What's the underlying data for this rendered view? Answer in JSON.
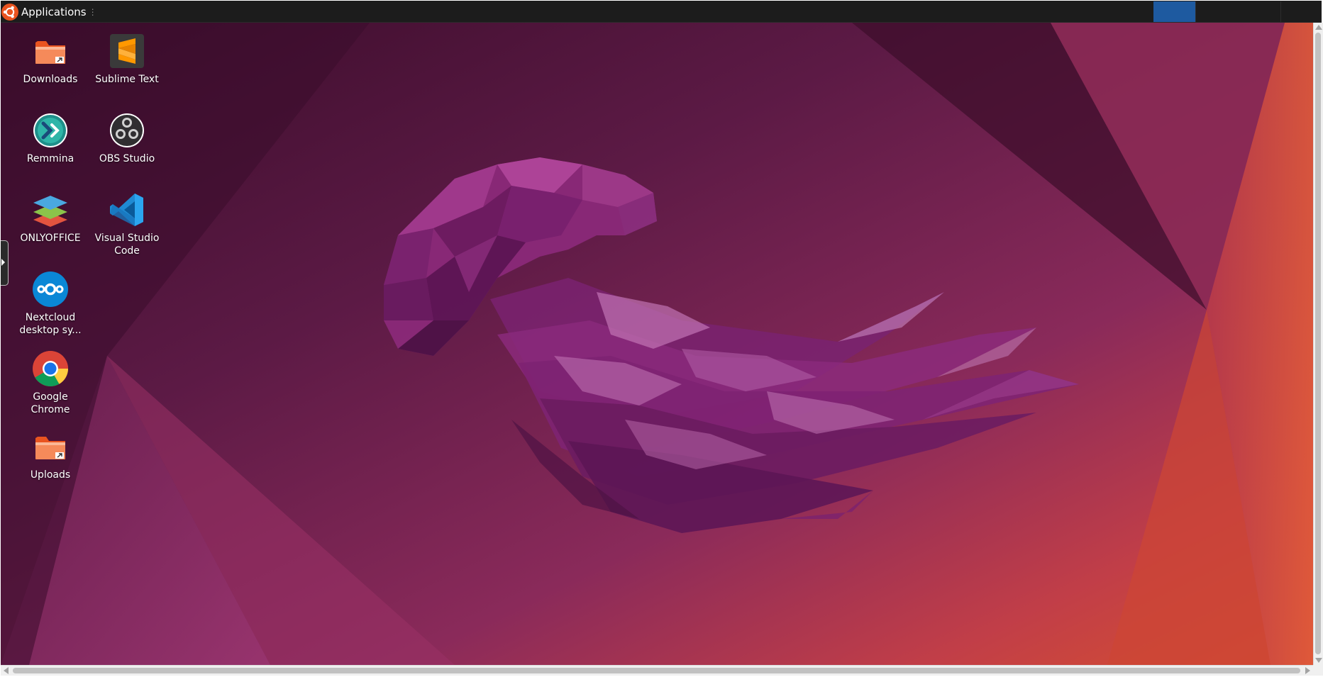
{
  "top_panel": {
    "apps_menu_label": "Applications",
    "apps_menu_icon": "ubuntu-logo-icon",
    "handle_glyph": "⋮"
  },
  "desktop": {
    "wallpaper": "ubuntu-jellyfish-wallpaper",
    "icons": [
      {
        "label": "Downloads",
        "icon": "folder-link-icon"
      },
      {
        "label": "Sublime Text",
        "icon": "sublime-text-icon"
      },
      {
        "label": "Remmina",
        "icon": "remmina-icon"
      },
      {
        "label": "OBS Studio",
        "icon": "obs-studio-icon"
      },
      {
        "label": "ONLYOFFICE",
        "icon": "onlyoffice-icon"
      },
      {
        "label": "Visual Studio Code",
        "icon": "vscode-icon"
      },
      {
        "label": "Nextcloud desktop sy...",
        "icon": "nextcloud-icon"
      },
      {
        "label": "Google Chrome",
        "icon": "chrome-icon"
      },
      {
        "label": "Uploads",
        "icon": "folder-link-icon"
      }
    ]
  },
  "colors": {
    "panel_bg": "#1c1c1c",
    "active_slot": "#1e5aa0",
    "wallpaper_dark": "#3a0c2a",
    "wallpaper_mid": "#7a2656",
    "wallpaper_warm": "#d8463a",
    "icon_label": "#ffffff"
  }
}
